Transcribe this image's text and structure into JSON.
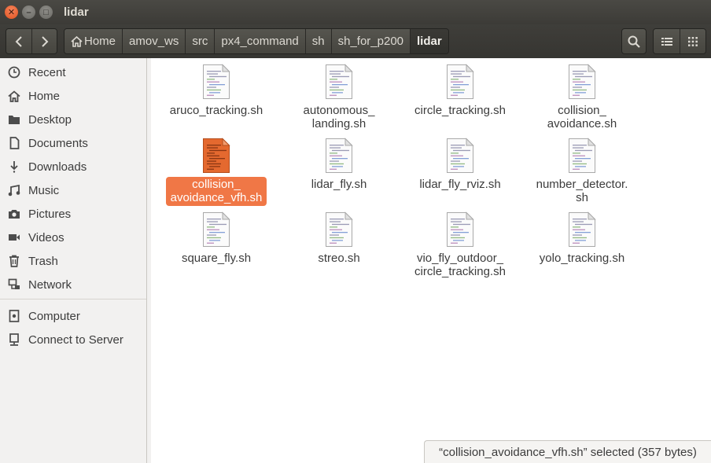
{
  "window": {
    "title": "lidar"
  },
  "breadcrumbs": [
    {
      "label": "Home"
    },
    {
      "label": "amov_ws"
    },
    {
      "label": "src"
    },
    {
      "label": "px4_command"
    },
    {
      "label": "sh"
    },
    {
      "label": "sh_for_p200"
    },
    {
      "label": "lidar"
    }
  ],
  "sidebar": {
    "items": [
      {
        "label": "Recent",
        "icon": "clock-icon"
      },
      {
        "label": "Home",
        "icon": "home-icon"
      },
      {
        "label": "Desktop",
        "icon": "folder-icon"
      },
      {
        "label": "Documents",
        "icon": "document-icon"
      },
      {
        "label": "Downloads",
        "icon": "download-icon"
      },
      {
        "label": "Music",
        "icon": "music-icon"
      },
      {
        "label": "Pictures",
        "icon": "camera-icon"
      },
      {
        "label": "Videos",
        "icon": "video-icon"
      },
      {
        "label": "Trash",
        "icon": "trash-icon"
      },
      {
        "label": "Network",
        "icon": "network-icon"
      }
    ],
    "devices": [
      {
        "label": "Computer",
        "icon": "computer-icon"
      },
      {
        "label": "Connect to Server",
        "icon": "server-icon"
      }
    ]
  },
  "files": [
    {
      "line1": "aruco_tracking.sh",
      "line2": "",
      "selected": false
    },
    {
      "line1": "autonomous_",
      "line2": "landing.sh",
      "selected": false
    },
    {
      "line1": "circle_tracking.sh",
      "line2": "",
      "selected": false
    },
    {
      "line1": "collision_",
      "line2": "avoidance.sh",
      "selected": false
    },
    {
      "line1": "collision_",
      "line2": "avoidance_vfh.sh",
      "selected": true
    },
    {
      "line1": "lidar_fly.sh",
      "line2": "",
      "selected": false
    },
    {
      "line1": "lidar_fly_rviz.sh",
      "line2": "",
      "selected": false
    },
    {
      "line1": "number_detector.",
      "line2": "sh",
      "selected": false
    },
    {
      "line1": "square_fly.sh",
      "line2": "",
      "selected": false
    },
    {
      "line1": "streo.sh",
      "line2": "",
      "selected": false
    },
    {
      "line1": "vio_fly_outdoor_",
      "line2": "circle_tracking.sh",
      "selected": false
    },
    {
      "line1": "yolo_tracking.sh",
      "line2": "",
      "selected": false
    }
  ],
  "status": {
    "text": "“collision_avoidance_vfh.sh” selected  (357 bytes)"
  },
  "colors": {
    "accent": "#f07746",
    "titlebar": "#3c3b37",
    "close": "#e2531f"
  }
}
